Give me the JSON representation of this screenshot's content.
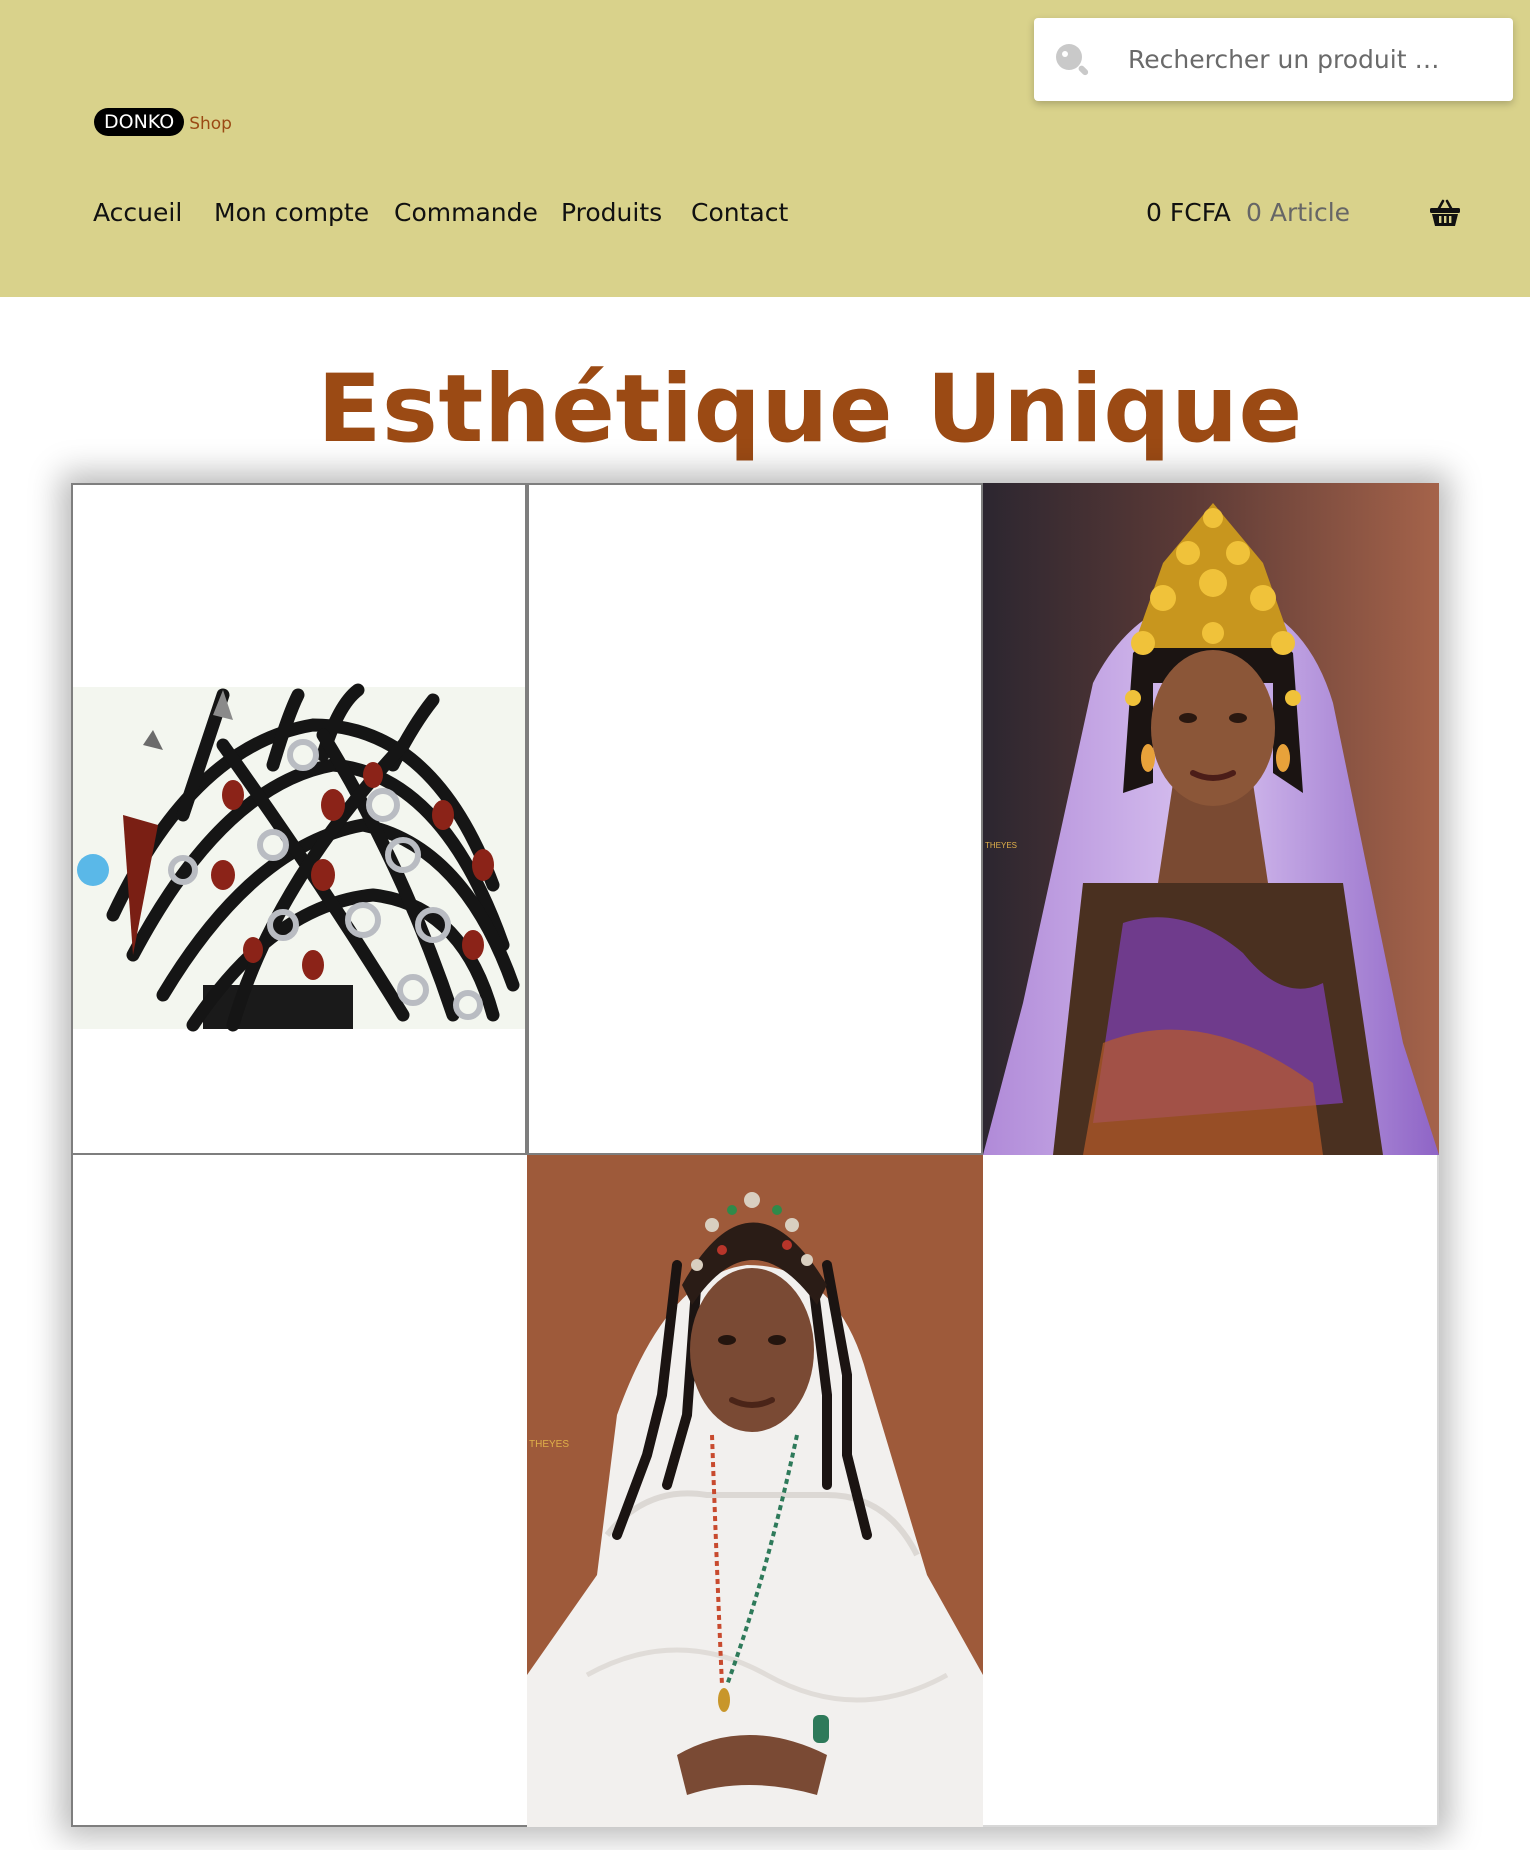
{
  "header": {
    "logo": {
      "brand": "DONKO",
      "suffix": "Shop"
    },
    "search": {
      "placeholder": "Rechercher un produit …"
    },
    "nav": [
      {
        "label": "Accueil"
      },
      {
        "label": "Mon compte"
      },
      {
        "label": "Commande"
      },
      {
        "label": "Produits"
      },
      {
        "label": "Contact"
      }
    ],
    "cart": {
      "total": "0 FCFA",
      "count": "0 Article",
      "icon": "basket-icon"
    }
  },
  "main": {
    "title": "Esthétique Unique",
    "gallery": [
      {
        "type": "product-image",
        "subject": "braided-headdress-with-beads"
      },
      {
        "type": "empty"
      },
      {
        "type": "photo",
        "subject": "woman-gold-crown-purple-veil",
        "watermark": "THEYES"
      },
      {
        "type": "empty"
      },
      {
        "type": "photo",
        "subject": "woman-beaded-braids-white-veil",
        "watermark": "THEYES"
      },
      {
        "type": "empty"
      }
    ]
  },
  "colors": {
    "header_bg": "#d9d28b",
    "accent": "#9b4a14",
    "text": "#111111"
  }
}
